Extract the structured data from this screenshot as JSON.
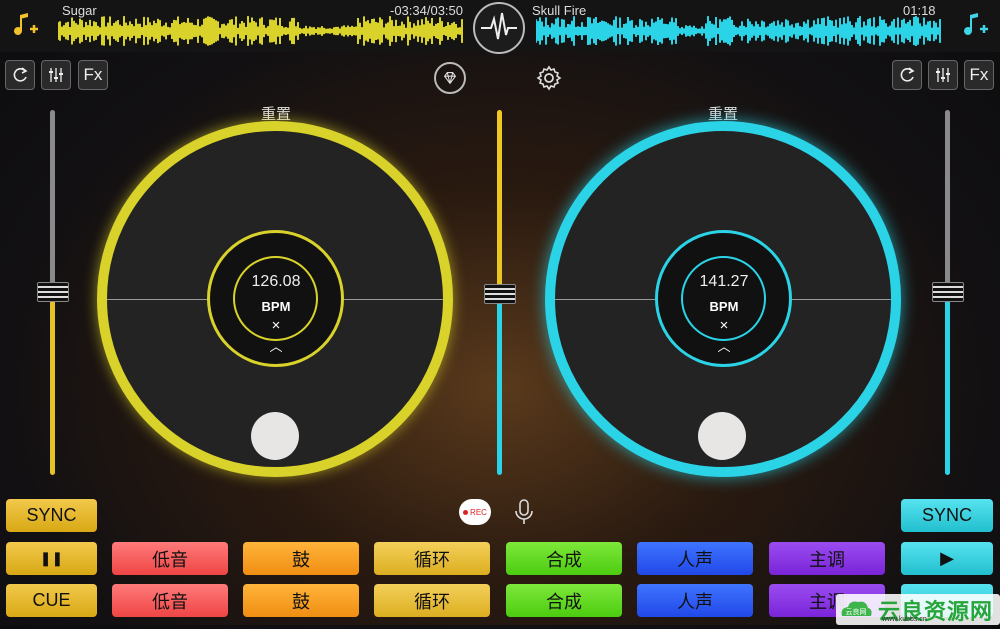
{
  "deckA": {
    "track_title": "Sugar",
    "track_time": "-03:34/03:50",
    "reset_label": "重置",
    "bpm": "126.08",
    "bpm_label": "BPM",
    "close_symbol": "×",
    "chevron_symbol": "︿",
    "accent_color": "#d9d22a",
    "tempo_slider_fraction": 0.5,
    "pads": {
      "sync": "SYNC",
      "pause": "❚❚",
      "cue": "CUE"
    }
  },
  "deckB": {
    "track_title": "Skull Fire",
    "track_time": "01:18",
    "reset_label": "重置",
    "bpm": "141.27",
    "bpm_label": "BPM",
    "close_symbol": "×",
    "chevron_symbol": "︿",
    "accent_color": "#2ad4e6",
    "tempo_slider_fraction": 0.5,
    "pads": {
      "sync": "SYNC",
      "play": "▶"
    }
  },
  "toolbar": {
    "fx_label": "Fx"
  },
  "crossfader_position": 0.5,
  "rec_label": "REC",
  "sample_pads": {
    "row1": [
      "低音",
      "鼓",
      "循环",
      "合成",
      "人声",
      "主调"
    ],
    "row2": [
      "低音",
      "鼓",
      "循环",
      "合成",
      "人声",
      "主调"
    ]
  },
  "colors": {
    "bass": "#ef4545",
    "drum": "#f08e12",
    "loop": "#dcae20",
    "synth": "#4ccc10",
    "vocal": "#2148e8",
    "lead": "#7a24d8"
  },
  "watermark": {
    "text": "云良资源网",
    "url": "www.kubbs.cn",
    "logo_text": "云良网"
  }
}
